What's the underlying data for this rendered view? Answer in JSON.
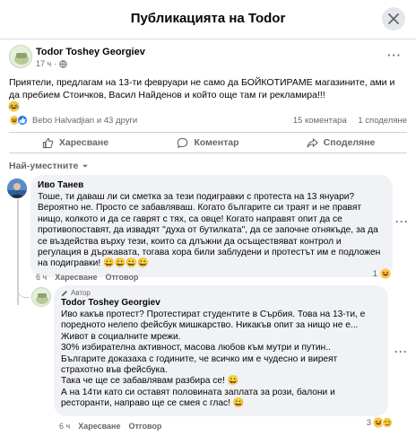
{
  "header": {
    "title": "Публикацията на Todor"
  },
  "post": {
    "author": "Todor Toshey Georgiev",
    "time": "17 ч",
    "privacy_icon": "globe-icon",
    "text": "Приятели, предлагам на 13-ти февруари не само да БОЙКОТИРАМЕ магазините, ами и да пребием Стоичков, Васил Найденов и който още там ги рекламира!!!",
    "reactions": {
      "names": "Bebo Halvadjian и 43 други",
      "comments": "15 коментара",
      "shares": "1 споделяне"
    },
    "actions": {
      "like": "Харесване",
      "comment": "Коментар",
      "share": "Споделяне"
    }
  },
  "sort": {
    "label": "Най-уместните"
  },
  "comments": [
    {
      "author": "Иво Танев",
      "text": "Тоше, ти даваш ли си сметка за тези подигравки с протеста на 13 януари? Вероятно не. Просто се забавляваш. Когато българите си траят и не правят нищо, колкото и да се гаврят с тях, са овце! Когато направят опит да се противопоставят, да извадят \"духа от бутилката\", да се започне отнякъде, за да се въздейства върху тези, които са длъжни да осъществяват контрол и регулация в държавата, тогава хора били заблудени и протестът им е подложен на подигравки! 😀😀😀😀",
      "time": "6 ч",
      "like": "Харесване",
      "reply": "Отговор",
      "count": "1"
    },
    {
      "badge": "Автор",
      "author": "Todor Toshey Georgiev",
      "lines": [
        "Иво какъв протест? Протестират студентите в Сърбия. Това на 13-ти, е поредното нелепо фейсбук мишкарство. Никакъв опит за нищо не е...",
        "Живот в социалните мрежи.",
        "30% избирателна активност, масова любов към мутри и путин..",
        "Българите доказаха с годините, че всичко им е чудесно и виреят страхотно във фейсбука.",
        "Така че ще се забавлявам разбира се! 😀",
        "А на 14ти като си оставят половината заплата за рози, балони и ресторанти, направо ще се смея с глас! 😀"
      ],
      "time": "6 ч",
      "like": "Харесване",
      "reply": "Отговор",
      "count": "3"
    }
  ]
}
